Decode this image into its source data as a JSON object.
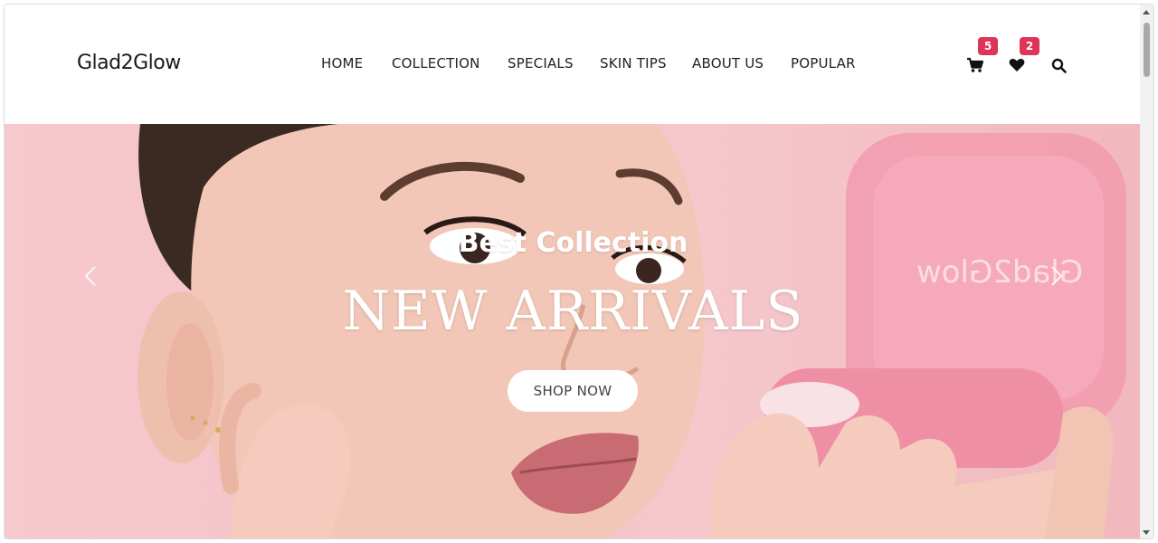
{
  "brand": {
    "logo_text": "Glad2Glow"
  },
  "nav": {
    "items": [
      {
        "label": "HOME"
      },
      {
        "label": "COLLECTION"
      },
      {
        "label": "SPECIALS"
      },
      {
        "label": "SKIN TIPS"
      },
      {
        "label": "ABOUT US"
      },
      {
        "label": "POPULAR"
      }
    ]
  },
  "header_icons": {
    "cart": {
      "icon": "cart-icon",
      "count": "5"
    },
    "wishlist": {
      "icon": "heart-icon",
      "count": "2"
    },
    "search": {
      "icon": "search-icon"
    }
  },
  "hero": {
    "subtitle": "Best Collection",
    "title": "NEW ARRIVALS",
    "cta_label": "SHOP NOW",
    "product_text": "Glad2Glow",
    "prev_icon": "chevron-left-icon",
    "next_icon": "chevron-right-icon"
  },
  "colors": {
    "badge": "#dc3557",
    "hero_background": "#f3c1c6",
    "text": "#222222"
  }
}
